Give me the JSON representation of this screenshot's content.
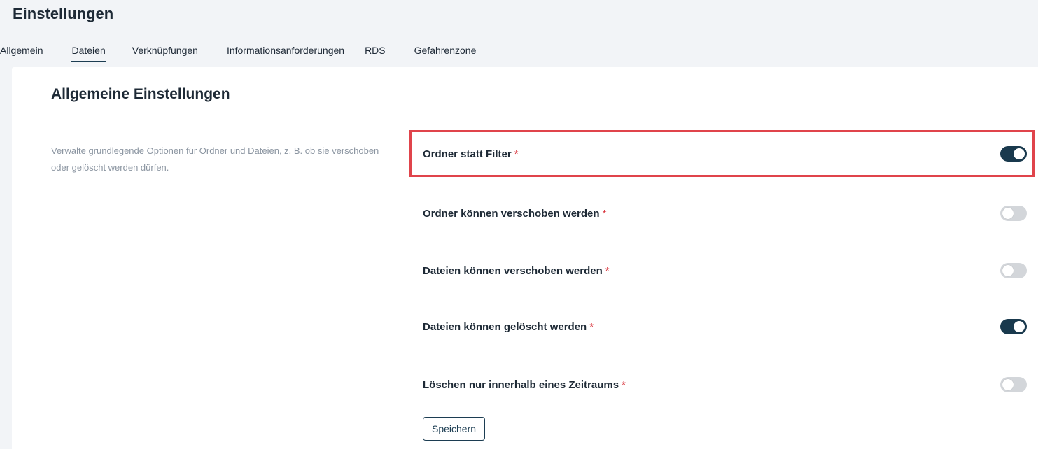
{
  "page": {
    "title": "Einstellungen"
  },
  "tabs": [
    {
      "label": "Allgemein",
      "active": false
    },
    {
      "label": "Dateien",
      "active": true
    },
    {
      "label": "Verknüpfungen",
      "active": false
    },
    {
      "label": "Informationsanforderungen",
      "active": false
    },
    {
      "label": "RDS",
      "active": false
    },
    {
      "label": "Gefahrenzone",
      "active": false
    }
  ],
  "section": {
    "title": "Allgemeine Einstellungen",
    "description": "Verwalte grundlegende Optionen für Ordner und Dateien, z. B. ob sie verschoben oder gelöscht werden dürfen."
  },
  "settings": [
    {
      "label": "Ordner statt Filter",
      "required_mark": "*",
      "enabled": true
    },
    {
      "label": "Ordner können verschoben werden",
      "required_mark": "*",
      "enabled": false
    },
    {
      "label": "Dateien können verschoben werden",
      "required_mark": "*",
      "enabled": false
    },
    {
      "label": "Dateien können gelöscht werden",
      "required_mark": "*",
      "enabled": true
    },
    {
      "label": "Löschen nur innerhalb eines Zeitraums",
      "required_mark": "*",
      "enabled": false
    }
  ],
  "actions": {
    "save_label": "Speichern"
  },
  "colors": {
    "accent": "#19394d",
    "highlight_border": "#e0444b",
    "required": "#d9363e",
    "toggle_off": "#d3d6da"
  }
}
